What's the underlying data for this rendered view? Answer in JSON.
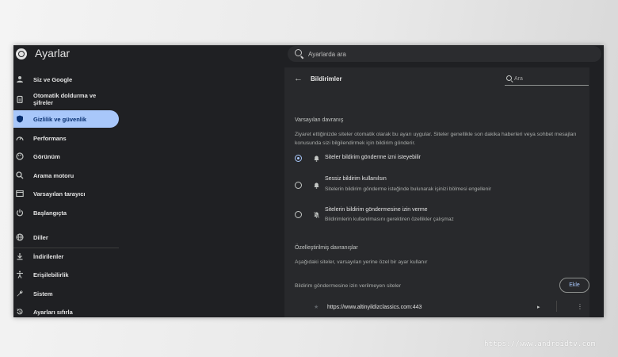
{
  "app": {
    "title": "Ayarlar",
    "logo_icon": "chrome-logo-icon"
  },
  "search": {
    "placeholder": "Ayarlarda ara"
  },
  "sidebar": {
    "items": [
      {
        "label": "Siz ve Google",
        "icon": "person-icon",
        "active": false
      },
      {
        "label": "Otomatik doldurma ve şifreler",
        "icon": "clipboard-icon",
        "active": false
      },
      {
        "label": "Gizlilik ve güvenlik",
        "icon": "shield-icon",
        "active": true
      },
      {
        "label": "Performans",
        "icon": "speedometer-icon",
        "active": false
      },
      {
        "label": "Görünüm",
        "icon": "palette-icon",
        "active": false
      },
      {
        "label": "Arama motoru",
        "icon": "search-icon",
        "active": false
      },
      {
        "label": "Varsayılan tarayıcı",
        "icon": "browser-icon",
        "active": false
      },
      {
        "label": "Başlangıçta",
        "icon": "power-icon",
        "active": false
      },
      {
        "label": "Diller",
        "icon": "globe-icon",
        "active": false
      },
      {
        "label": "İndirilenler",
        "icon": "download-icon",
        "active": false
      },
      {
        "label": "Erişilebilirlik",
        "icon": "accessibility-icon",
        "active": false
      },
      {
        "label": "Sistem",
        "icon": "wrench-icon",
        "active": false
      },
      {
        "label": "Ayarları sıfırla",
        "icon": "reset-icon",
        "active": false
      }
    ]
  },
  "page": {
    "title": "Bildirimler",
    "search_placeholder": "Ara",
    "default_section": {
      "title": "Varsayılan davranış",
      "description": "Ziyaret ettiğinizde siteler otomatik olarak bu ayarı uygular. Siteler genellikle son dakika haberleri veya sohbet mesajları konusunda sizi bilgilendirmek için bildirim gönderir.",
      "options": [
        {
          "label": "Siteler bildirim gönderme izni isteyebilir",
          "description": "",
          "selected": true,
          "icon": "bell-icon"
        },
        {
          "label": "Sessiz bildirim kullanılsın",
          "description": "Sitelerin bildirim gönderme isteğinde bulunarak işinizi bölmesi engellenir",
          "selected": false,
          "icon": "bell-icon"
        },
        {
          "label": "Sitelerin bildirim göndermesine izin verme",
          "description": "Bildirimlerin kullanılmasını gerektiren özellikler çalışmaz",
          "selected": false,
          "icon": "bell-off-icon"
        }
      ]
    },
    "custom_section": {
      "title": "Özelleştirilmiş davranışlar",
      "description": "Aşağıdaki siteler, varsayılan yerine özel bir ayar kullanır",
      "blocked_label": "Bildirim göndermesine izin verilmeyen siteler",
      "add_button": "Ekle",
      "sites": [
        {
          "url": "https://www.altinyildizclassics.com:443"
        }
      ]
    }
  },
  "watermark": "https://www.androidtv.com",
  "colors": {
    "background": "#1f2023",
    "content_background": "#28292c",
    "accent": "#a8c7fa",
    "active_text": "#062e6f"
  }
}
